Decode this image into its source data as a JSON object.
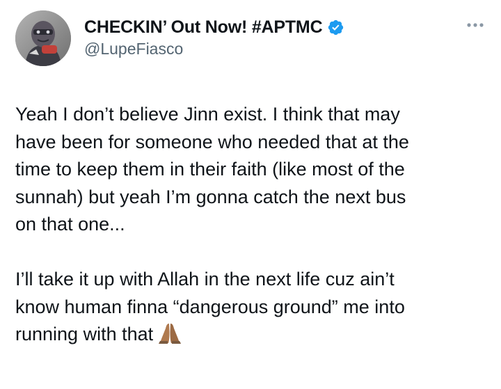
{
  "author": {
    "display_name": "CHECKIN’ Out Now! #APTMC",
    "handle": "@LupeFiasco",
    "verified": true,
    "avatar_icon": "avatar-image"
  },
  "menu": {
    "icon": "more-options-icon"
  },
  "tweet": {
    "paragraph_1": [
      "Yeah I don’t believe Jinn exist. I think that may",
      "have been for someone who needed that at the",
      "time to keep them in their faith (like most of the",
      "sunnah) but yeah I’m gonna catch the next bus",
      "on that one..."
    ],
    "paragraph_2": [
      "I’ll take it up with Allah in the next life cuz ain’t",
      "know human finna “dangerous ground” me into",
      "running with that"
    ],
    "emoji": "praying-hands-emoji"
  },
  "colors": {
    "text": "#0f1419",
    "secondary": "#536471",
    "verified_blue": "#1d9bf0",
    "emoji_skin": "#b07a4f"
  }
}
